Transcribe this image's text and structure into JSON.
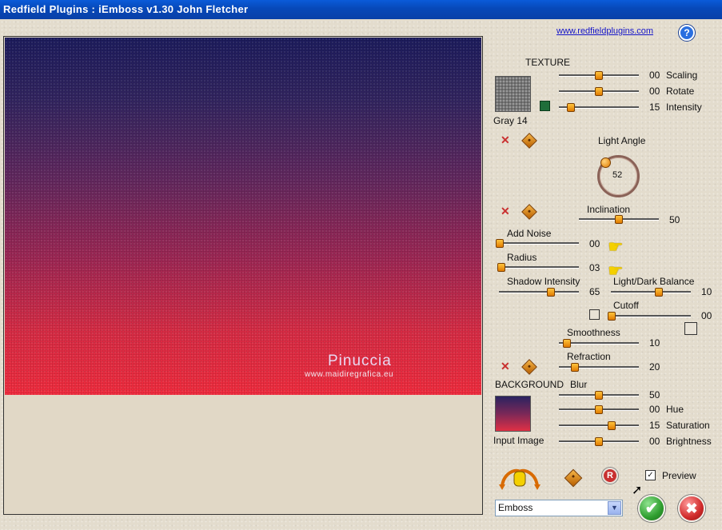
{
  "window": {
    "title": "Redfield  Plugins  :  iEmboss  v1.30   John Fletcher"
  },
  "header": {
    "website_link": "www.redfieldplugins.com",
    "help_icon": "help-icon"
  },
  "preview": {
    "watermark_name": "Pinuccia",
    "watermark_url": "www.maidiregrafica.eu"
  },
  "texture": {
    "heading": "TEXTURE",
    "name": "Gray 14",
    "sliders": [
      {
        "label": "Scaling",
        "value": "00"
      },
      {
        "label": "Rotate",
        "value": "00"
      },
      {
        "label": "Intensity",
        "value": "15"
      }
    ]
  },
  "light_angle": {
    "label": "Light  Angle",
    "value": "52"
  },
  "inclination": {
    "label": "Inclination",
    "value": "50"
  },
  "add_noise": {
    "label": "Add Noise",
    "value": "00"
  },
  "radius": {
    "label": "Radius",
    "value": "03"
  },
  "shadow_intensity": {
    "label": "Shadow Intensity",
    "value": "65"
  },
  "light_dark_balance": {
    "label": "Light/Dark Balance",
    "value": "10"
  },
  "cutoff": {
    "label": "Cutoff",
    "value": "00"
  },
  "smoothness": {
    "label": "Smoothness",
    "value": "10"
  },
  "refraction": {
    "label": "Refraction",
    "value": "20"
  },
  "background": {
    "heading": "BACKGROUND",
    "source": "Input Image",
    "blur": {
      "label": "Blur",
      "value": "50"
    },
    "sliders": [
      {
        "label": "Hue",
        "value": "00"
      },
      {
        "label": "Saturation",
        "value": "15"
      },
      {
        "label": "Brightness",
        "value": "00"
      }
    ]
  },
  "footer": {
    "preview_label": "Preview",
    "preview_checked": true,
    "mode_select": "Emboss",
    "reset_glyph": "R",
    "ok_glyph": "✔",
    "cancel_glyph": "✖"
  },
  "colors": {
    "titlebar": "#0748b8",
    "accent_thumb": "#f0a020",
    "ok": "#2f9e2f",
    "cancel": "#d02a2a"
  }
}
